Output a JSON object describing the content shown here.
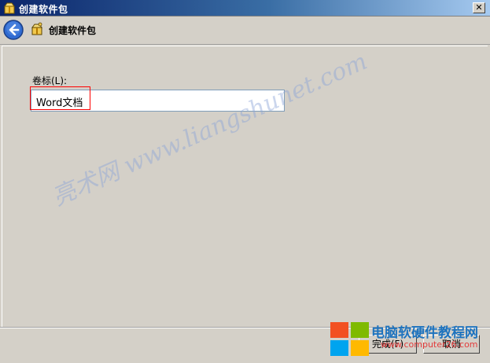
{
  "window": {
    "title": "创建软件包"
  },
  "header": {
    "title": "创建软件包"
  },
  "form": {
    "volume_label": "卷标(L):",
    "volume_value": "Word文档"
  },
  "buttons": {
    "finish": "完成(F)",
    "cancel": "取消"
  },
  "watermark": "亮术网 www.liangshunet.com",
  "brand": {
    "name": "电脑软硬件教程网",
    "url": "www.computer26.com"
  },
  "icons": {
    "app": "package-icon",
    "back": "back-arrow-icon",
    "wizard": "package-icon",
    "close": "close-icon",
    "brand_logo": "windows-logo-icon"
  },
  "colors": {
    "window_bg": "#d4d0c8",
    "title_bar": "#0a246a",
    "highlight": "#ff0000",
    "brand_blue": "#1e73be"
  }
}
